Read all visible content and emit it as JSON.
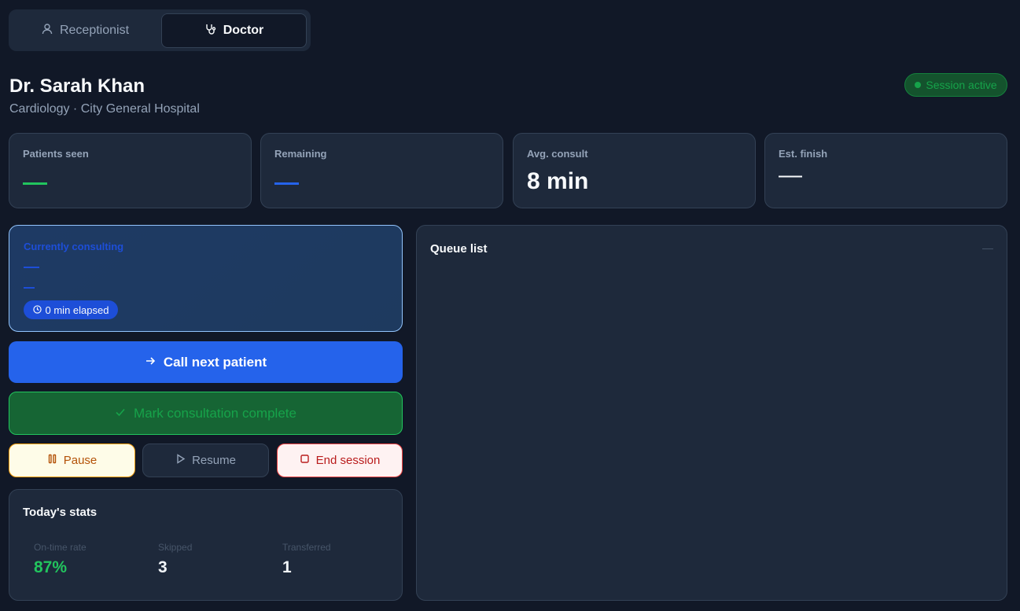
{
  "roles": {
    "receptionist_label": "Receptionist",
    "doctor_label": "Doctor",
    "active": "Doctor"
  },
  "header": {
    "doctor_name": "Dr. Sarah Khan",
    "subtitle": "Cardiology · City General Hospital",
    "session_status": "Session active"
  },
  "stats": {
    "patients_seen": {
      "label": "Patients seen",
      "value": ""
    },
    "remaining": {
      "label": "Remaining",
      "value": ""
    },
    "avg_consult": {
      "label": "Avg. consult",
      "value": "8 min"
    },
    "est_finish": {
      "label": "Est. finish",
      "value": "—"
    }
  },
  "current": {
    "caption": "Currently consulting",
    "elapsed": "0 min elapsed"
  },
  "actions": {
    "call_next": "Call next patient",
    "mark_complete": "Mark consultation complete",
    "pause": "Pause",
    "resume": "Resume",
    "end_session": "End session"
  },
  "today": {
    "title": "Today's stats",
    "items": [
      {
        "label": "On-time rate",
        "value": "87%"
      },
      {
        "label": "Skipped",
        "value": "3"
      },
      {
        "label": "Transferred",
        "value": "1"
      }
    ]
  },
  "queue": {
    "title": "Queue list",
    "count": "—"
  },
  "colors": {
    "background": "#111827",
    "card": "#1e293b",
    "primary": "#2563eb",
    "success": "#22c55e",
    "warning": "#f59e0b",
    "danger": "#ef4444"
  },
  "icons": {
    "receptionist": "person-icon",
    "doctor": "stethoscope-icon",
    "elapsed": "clock-icon",
    "call_next": "arrow-right-icon",
    "mark_complete": "check-icon",
    "pause": "pause-icon",
    "resume": "play-icon",
    "end_session": "stop-icon"
  }
}
